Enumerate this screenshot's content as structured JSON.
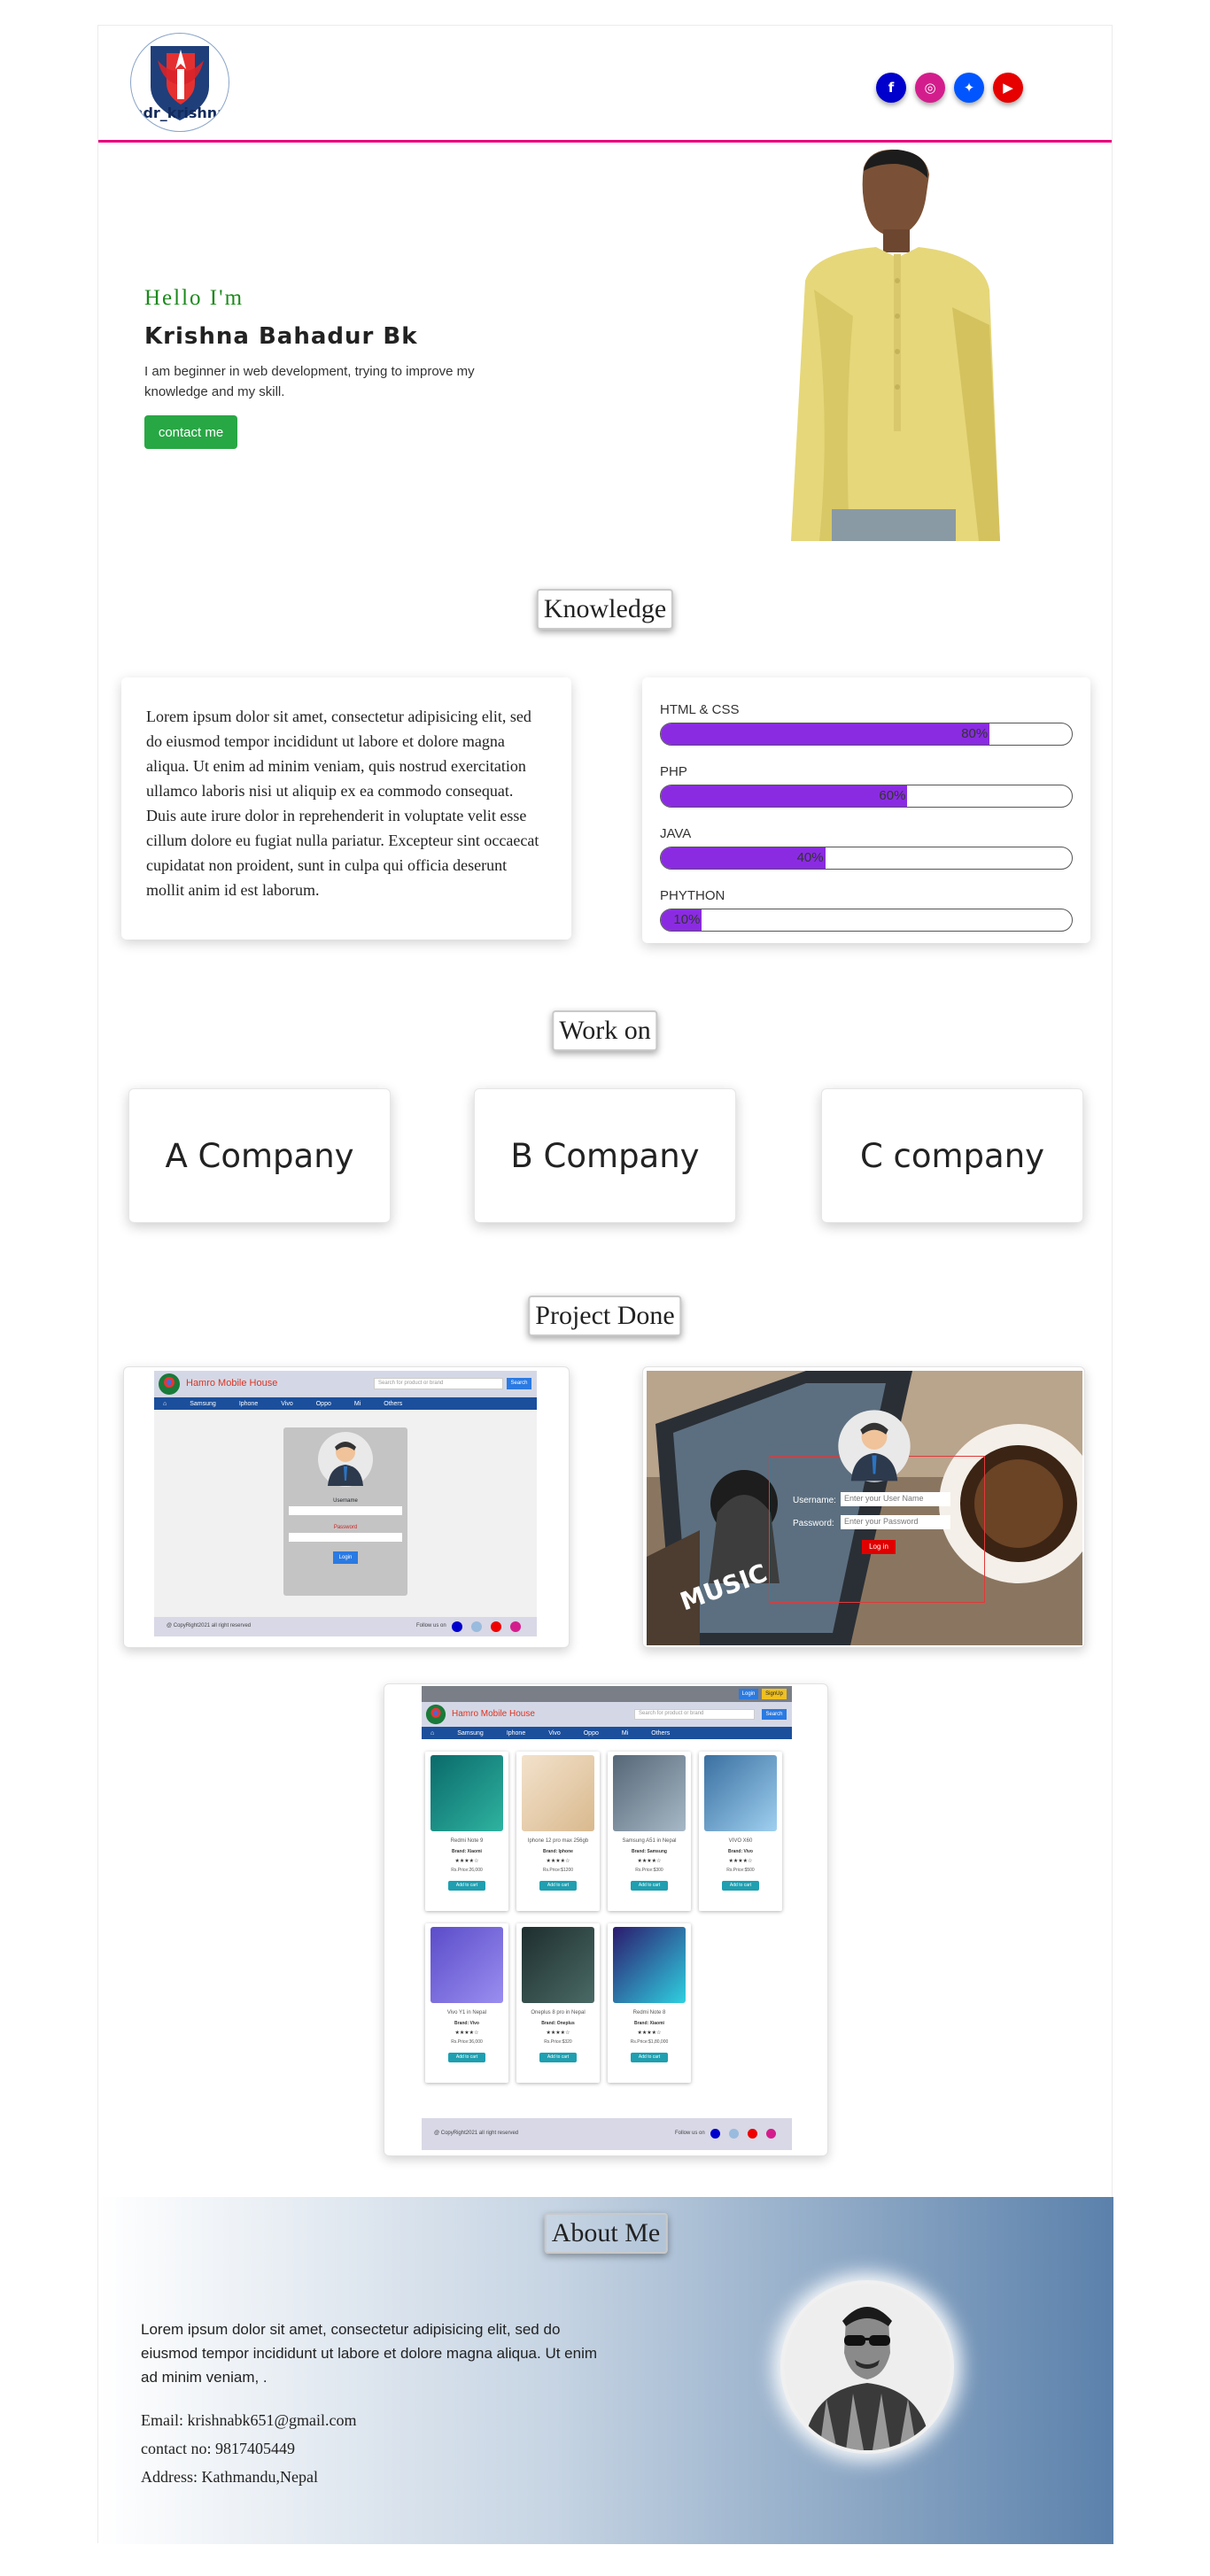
{
  "header": {
    "logo_text": "hdr_krishna",
    "social_links": [
      {
        "icon": "facebook-icon",
        "glyph": "f",
        "color": "#0000cc"
      },
      {
        "icon": "instagram-icon",
        "glyph": "◎",
        "color": "#d41d8c"
      },
      {
        "icon": "twitter-icon",
        "glyph": "✦",
        "color": "#0055ff"
      },
      {
        "icon": "youtube-icon",
        "glyph": "▶",
        "color": "#e60000"
      }
    ]
  },
  "hero": {
    "greeting": "Hello I'm",
    "name": "Krishna Bahadur Bk",
    "intro": "I am beginner in web development, trying to improve my knowledge and my skill.",
    "contact_button": "contact me"
  },
  "knowledge": {
    "title": "Knowledge",
    "text": "Lorem ipsum dolor sit amet, consectetur adipisicing elit, sed do eiusmod tempor incididunt ut labore et dolore magna aliqua. Ut enim ad minim veniam, quis nostrud exercitation ullamco laboris nisi ut aliquip ex ea commodo consequat. Duis aute irure dolor in reprehenderit in voluptate velit esse cillum dolore eu fugiat nulla pariatur. Excepteur sint occaecat cupidatat non proident, sunt in culpa qui officia deserunt mollit anim id est laborum.",
    "skills": [
      {
        "name": "HTML & CSS",
        "percent": 80,
        "label": "80%"
      },
      {
        "name": "PHP",
        "percent": 60,
        "label": "60%"
      },
      {
        "name": "JAVA",
        "percent": 40,
        "label": "40%"
      },
      {
        "name": "PHYTHON",
        "percent": 10,
        "label": "10%"
      }
    ]
  },
  "work": {
    "title": "Work on",
    "companies": [
      "A Company",
      "B Company",
      "C company"
    ]
  },
  "projects": {
    "title": "Project Done",
    "p1": {
      "site_name": "Hamro Mobile House",
      "search_placeholder": "Search for product or brand",
      "search_button": "Search",
      "nav": [
        "Samsung",
        "Iphone",
        "Vivo",
        "Oppo",
        "Mi",
        "Others"
      ],
      "username_label": "Username",
      "password_label": "Password",
      "login_button": "Login",
      "footer_copy": "@ CopyRight2021 all right reserved",
      "footer_follow": "Follow us on"
    },
    "p2": {
      "username_label": "Username:",
      "username_placeholder": "Enter your User Name",
      "password_label": "Password:",
      "password_placeholder": "Enter your Password",
      "login_button": "Log in",
      "music_text": "MUSIC"
    },
    "p3": {
      "site_name": "Hamro Mobile House",
      "login_button": "Login",
      "signup_button": "SignUp",
      "search_placeholder": "Search for product or brand",
      "search_button": "Search",
      "nav": [
        "Samsung",
        "Iphone",
        "Vivo",
        "Oppo",
        "Mi",
        "Others"
      ],
      "footer_copy": "@ CopyRight2021 all right reserved",
      "footer_follow": "Follow us on",
      "add_to_cart": "Add to cart",
      "products": [
        {
          "title": "Redmi Note 9",
          "brand": "Brand: Xiaomi",
          "price": "Rs.Price:26,000",
          "colors": [
            "#0a6a6a",
            "#2fb3a0"
          ]
        },
        {
          "title": "Iphone 12 pro max 256gb",
          "brand": "Brand: Iphone",
          "price": "Rs.Price:$1200",
          "colors": [
            "#f3e2cc",
            "#d9b98e"
          ]
        },
        {
          "title": "Samsung A51 in Nepal",
          "brand": "Brand: Samsung",
          "price": "Rs.Price:$300",
          "colors": [
            "#556677",
            "#a7b8c6"
          ]
        },
        {
          "title": "VIVO X60",
          "brand": "Brand: Vivo",
          "price": "Rs.Price:$500",
          "colors": [
            "#3a6fa0",
            "#9fd0f0"
          ]
        },
        {
          "title": "Vivo Y1 in Nepal",
          "brand": "Brand: Vivo",
          "price": "Rs.Price:36,000",
          "colors": [
            "#5b4cc9",
            "#9a8ef0"
          ]
        },
        {
          "title": "Oneplus 8 pro in Nepal",
          "brand": "Brand: Oneplus",
          "price": "Rs.Price:$320",
          "colors": [
            "#1e2e2e",
            "#4a6a66"
          ]
        },
        {
          "title": "Redmi Note 8",
          "brand": "Brand: Xiaomi",
          "price": "Rs.Price:$1,80,000",
          "colors": [
            "#2c1a6e",
            "#2fd0e0"
          ]
        }
      ]
    }
  },
  "about": {
    "title": "About Me",
    "text": "Lorem ipsum dolor sit amet, consectetur adipisicing elit, sed do eiusmod tempor incididunt ut labore et dolore magna aliqua. Ut enim ad minim veniam, .",
    "email": "Email: krishnabk651@gmail.com",
    "phone": "contact no: 9817405449",
    "address": "Address: Kathmandu,Nepal"
  }
}
